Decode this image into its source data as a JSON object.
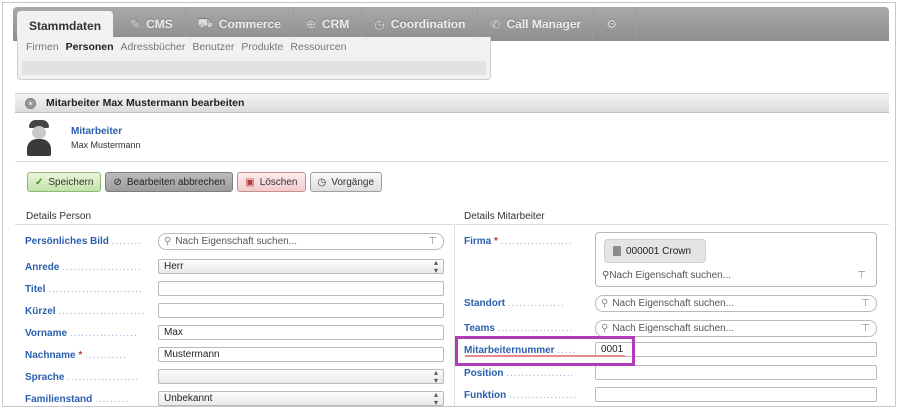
{
  "topnav": {
    "tabs": [
      {
        "label": "Stammdaten",
        "icon": "",
        "active": true
      },
      {
        "label": "CMS",
        "icon": "edit-icon",
        "active": false
      },
      {
        "label": "Commerce",
        "icon": "cart-icon",
        "active": false
      },
      {
        "label": "CRM",
        "icon": "crm-icon",
        "active": false
      },
      {
        "label": "Coordination",
        "icon": "clock-icon",
        "active": false
      },
      {
        "label": "Call Manager",
        "icon": "phone-icon",
        "active": false
      },
      {
        "label": "",
        "icon": "gear-icon",
        "active": false
      }
    ]
  },
  "subnav": {
    "items": [
      "Firmen",
      "Personen",
      "Adressbücher",
      "Benutzer",
      "Produkte",
      "Ressourcen"
    ],
    "active": "Personen"
  },
  "panel": {
    "title": "Mitarbeiter Max Mustermann bearbeiten"
  },
  "user": {
    "role": "Mitarbeiter",
    "name": "Max Mustermann"
  },
  "actions": {
    "save": "Speichern",
    "cancel": "Bearbeiten abbrechen",
    "delete": "Löschen",
    "processes": "Vorgänge"
  },
  "person": {
    "section_title": "Details Person",
    "fields": {
      "bild_label": "Persönliches Bild",
      "bild_placeholder": "Nach Eigenschaft suchen...",
      "anrede_label": "Anrede",
      "anrede_value": "Herr",
      "titel_label": "Titel",
      "titel_value": "",
      "kuerzel_label": "Kürzel",
      "kuerzel_value": "",
      "vorname_label": "Vorname",
      "vorname_value": "Max",
      "nachname_label": "Nachname",
      "nachname_value": "Mustermann",
      "sprache_label": "Sprache",
      "sprache_value": "",
      "familienstand_label": "Familienstand",
      "familienstand_value": "Unbekannt"
    }
  },
  "employee": {
    "section_title": "Details Mitarbeiter",
    "fields": {
      "firma_label": "Firma",
      "firma_chip": "000001 Crown",
      "firma_placeholder": "Nach Eigenschaft suchen...",
      "standort_label": "Standort",
      "standort_placeholder": "Nach Eigenschaft suchen...",
      "teams_label": "Teams",
      "teams_placeholder": "Nach Eigenschaft suchen...",
      "mitarbeiternummer_label": "Mitarbeiternummer",
      "mitarbeiternummer_value": "0001",
      "position_label": "Position",
      "position_value": "",
      "funktion_label": "Funktion",
      "funktion_value": ""
    }
  },
  "colors": {
    "label_blue": "#2a5fae",
    "highlight": "#b23cb8",
    "required": "#c0392b"
  }
}
